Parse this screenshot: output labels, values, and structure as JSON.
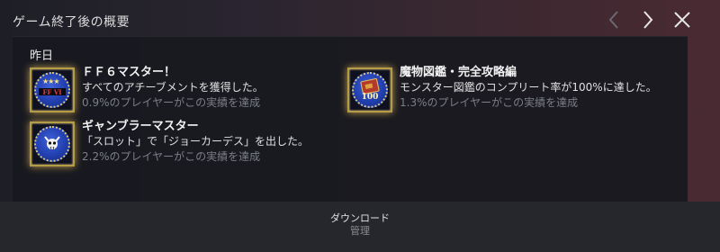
{
  "header": {
    "title": "ゲーム終了後の概要"
  },
  "section": {
    "label": "昨日"
  },
  "achievements": [
    {
      "name": "ＦＦ６マスター！",
      "description": "すべてのアチーブメントを獲得した。",
      "rate": "0.9%のプレイヤーがこの実績を達成",
      "icon": "ff6-emblem-medal-icon"
    },
    {
      "name": "魔物図鑑・完全攻略編",
      "description": "モンスター図鑑のコンプリート率が100%に達した。",
      "rate": "1.3%のプレイヤーがこの実績を達成",
      "icon": "bestiary-book-medal-icon",
      "badge_text": "100"
    },
    {
      "name": "ギャンブラーマスター",
      "description": "「スロット」で「ジョーカーデス」を出した。",
      "rate": "2.2%のプレイヤーがこの実績を達成",
      "icon": "joker-skull-medal-icon"
    }
  ],
  "footer": {
    "download": "ダウンロード",
    "manage": "管理"
  },
  "colors": {
    "medal_blue": "#2340b0",
    "glow_gold": "#b59c46",
    "panel_bg": "#18191f",
    "footer_bg": "#26272c"
  }
}
